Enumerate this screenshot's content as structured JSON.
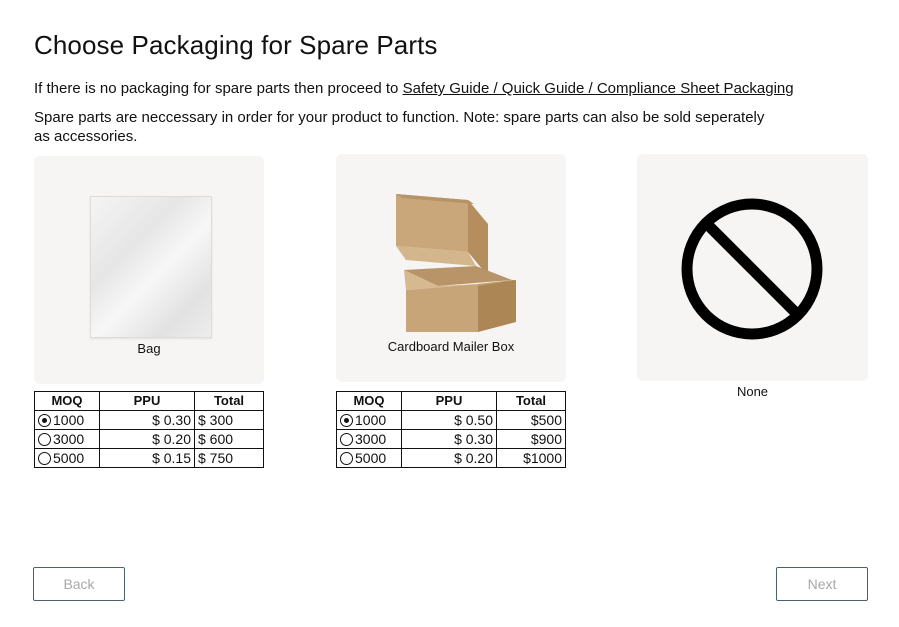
{
  "page": {
    "title": "Choose Packaging for Spare Parts",
    "intro_prefix": "If there is no packaging for spare parts then proceed to",
    "intro_link": "Safety Guide / Quick Guide / Compliance Sheet Packaging",
    "description": "Spare parts are neccessary in order for your product to function. Note: spare parts can also be sold seperately as accessories."
  },
  "options": [
    {
      "label": "Bag",
      "icon": "plastic-bag-image",
      "table": {
        "headers": [
          "MOQ",
          "PPU",
          "Total"
        ],
        "rows": [
          {
            "moq": "1000",
            "ppu": "$ 0.30",
            "total": "$ 300",
            "selected": true
          },
          {
            "moq": "3000",
            "ppu": "$ 0.20",
            "total": "$ 600",
            "selected": false
          },
          {
            "moq": "5000",
            "ppu": "$ 0.15",
            "total": "$ 750",
            "selected": false
          }
        ]
      }
    },
    {
      "label": "Cardboard Mailer Box",
      "icon": "cardboard-box-image",
      "table": {
        "headers": [
          "MOQ",
          "PPU",
          "Total"
        ],
        "rows": [
          {
            "moq": "1000",
            "ppu": "$ 0.50",
            "total": "$500",
            "selected": true
          },
          {
            "moq": "3000",
            "ppu": "$ 0.30",
            "total": "$900",
            "selected": false
          },
          {
            "moq": "5000",
            "ppu": "$ 0.20",
            "total": "$1000",
            "selected": false
          }
        ]
      }
    },
    {
      "label": "None",
      "icon": "prohibited-icon"
    }
  ],
  "nav": {
    "back_label": "Back",
    "next_label": "Next"
  }
}
